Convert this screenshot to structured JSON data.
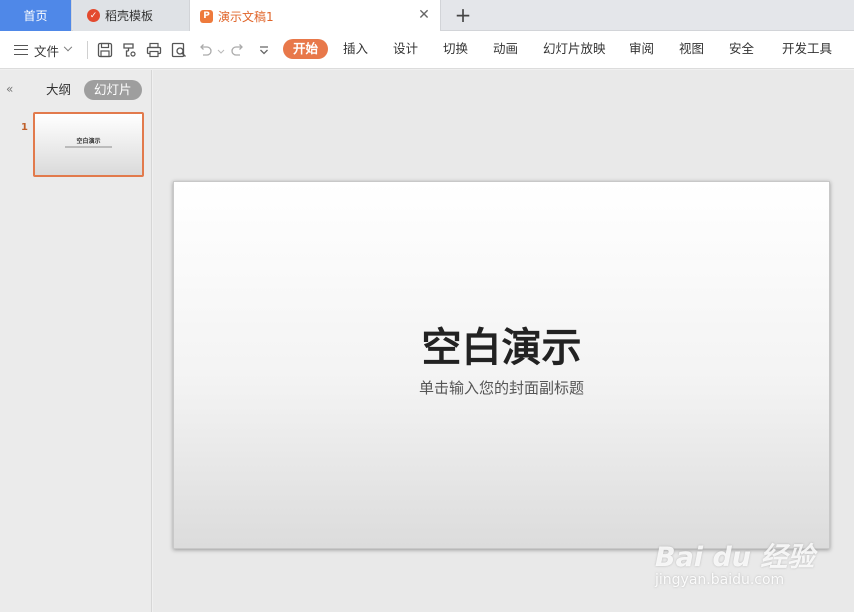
{
  "tabs": {
    "home": "首页",
    "daoke": "稻壳模板",
    "doc": "演示文稿1",
    "add_icon": "plus-icon",
    "close_icon": "close-icon"
  },
  "toolbar": {
    "file_menu": "文件",
    "ribbon_tabs": [
      "开始",
      "插入",
      "设计",
      "切换",
      "动画",
      "幻灯片放映",
      "审阅",
      "视图",
      "安全",
      "开发工具"
    ],
    "active_tab": "开始"
  },
  "panel": {
    "outline_tab": "大纲",
    "slides_tab": "幻灯片",
    "slide_number": "1",
    "thumb_title": "空白演示"
  },
  "slide": {
    "title": "空白演示",
    "subtitle": "单击输入您的封面副标题"
  },
  "watermark": {
    "logo": "Bai du 经验",
    "url": "jingyan.baidu.com"
  },
  "colors": {
    "accent": "#e8784a",
    "home_tab": "#4f88e8",
    "doc_tab_text": "#e0652a"
  }
}
